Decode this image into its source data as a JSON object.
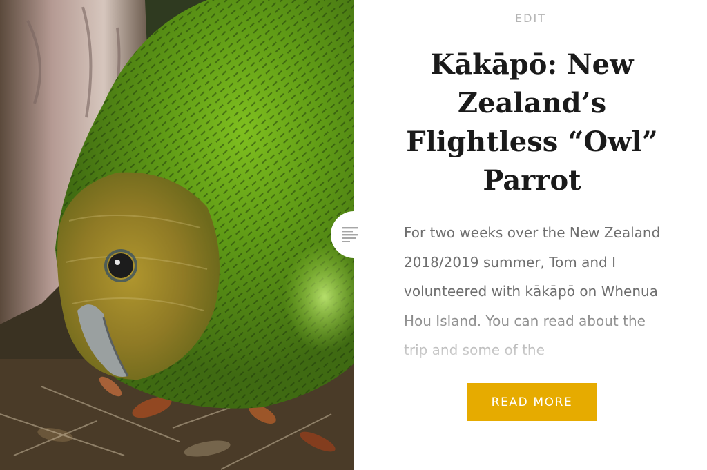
{
  "post": {
    "edit_label": "EDIT",
    "title": "Kākāpō: New Zealand’s Flightless “Owl” Parrot",
    "excerpt": "For two weeks over the New Zealand 2018/2019 summer, Tom and I volunteered with kākāpō on Whenua Hou Island. You can read about the trip and some of the",
    "read_more_label": "READ MORE",
    "image_subject": "kakapo parrot in leaf litter",
    "format_icon": "text-lines-icon"
  },
  "colors": {
    "button": "#e6ab00",
    "title": "#1a1a1a",
    "excerpt": "#6f6f6f",
    "edit": "#b4b4b4"
  }
}
